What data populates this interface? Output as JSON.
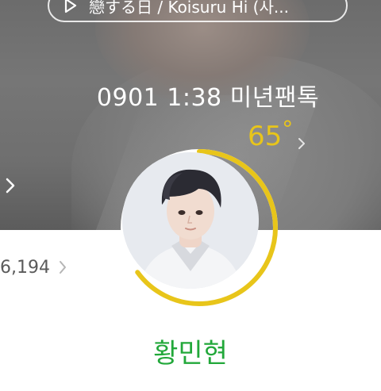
{
  "music": {
    "title": "戀する日 / Koisuru Hi (사...",
    "icon": "play-icon"
  },
  "status_message": "0901 1:38 미년팬톡",
  "profile": {
    "name": "황민현",
    "temperature": "65",
    "temperature_unit": "°",
    "temperature_percent": 65,
    "count_text": "6,194"
  },
  "colors": {
    "temperature": "#e8c51a",
    "name": "#22a83a",
    "cover": "#6f6f6f"
  }
}
